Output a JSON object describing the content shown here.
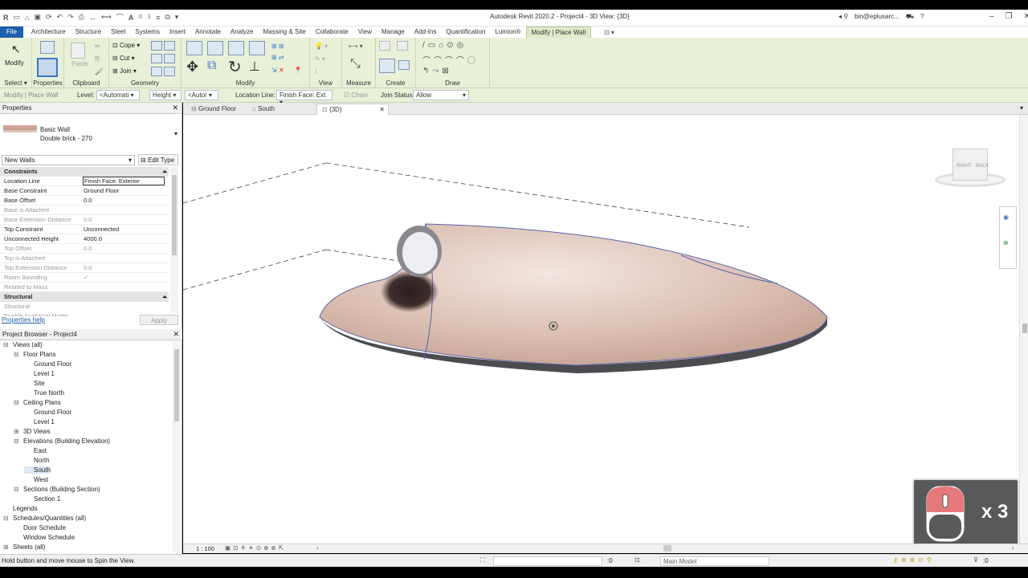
{
  "window": {
    "title": "Autodesk Revit 2020.2 - Project4 - 3D View: {3D}",
    "user": "bin@eplusarc...",
    "controls": [
      "minimize-icon",
      "restore-icon",
      "close-icon"
    ]
  },
  "menu": {
    "file": "File",
    "tabs": [
      "Architecture",
      "Structure",
      "Steel",
      "Systems",
      "Insert",
      "Annotate",
      "Analyze",
      "Massing & Site",
      "Collaborate",
      "View",
      "Manage",
      "Add-Ins",
      "Quantification",
      "Lumion®",
      "Modify | Place Wall"
    ],
    "active_tab": "Modify | Place Wall"
  },
  "ribbon": {
    "modify": "Modify",
    "paste": "Paste",
    "cope": "Cope",
    "cut": "Cut",
    "join": "Join",
    "groups": [
      "Select",
      "Properties",
      "Clipboard",
      "Geometry",
      "Modify",
      "View",
      "Measure",
      "Create",
      "Draw"
    ]
  },
  "options_bar": {
    "context": "Modify | Place Wall",
    "level_label": "Level:",
    "level_value": "<Automati",
    "height_label": "Height",
    "height_value": "<Autor",
    "location_label": "Location Line:",
    "location_value": "Finish Face: Ext",
    "chain": "Chain",
    "join_label": "Join Status:",
    "join_value": "Allow"
  },
  "properties": {
    "header": "Properties",
    "type_name": "Basic Wall",
    "type_sub": "Double brick - 270",
    "filter": "New Walls",
    "edit_type": "Edit Type",
    "sections": {
      "constraints": "Constraints",
      "structural": "Structural"
    },
    "rows": [
      {
        "key": "Location Line",
        "value": "Finish Face: Exterior",
        "dim": false
      },
      {
        "key": "Base Constraint",
        "value": "Ground Floor",
        "dim": false
      },
      {
        "key": "Base Offset",
        "value": "0.0",
        "dim": false
      },
      {
        "key": "Base is Attached",
        "value": "",
        "dim": true
      },
      {
        "key": "Base Extension Distance",
        "value": "0.0",
        "dim": true
      },
      {
        "key": "Top Constraint",
        "value": "Unconnected",
        "dim": false
      },
      {
        "key": "Unconnected Height",
        "value": "4000.0",
        "dim": false
      },
      {
        "key": "Top Offset",
        "value": "0.0",
        "dim": true
      },
      {
        "key": "Top is Attached",
        "value": "",
        "dim": true
      },
      {
        "key": "Top Extension Distance",
        "value": "0.0",
        "dim": true
      },
      {
        "key": "Room Bounding",
        "value": "✓",
        "dim": true
      },
      {
        "key": "Related to Mass",
        "value": "",
        "dim": true
      }
    ],
    "structural_rows": [
      {
        "key": "Structural",
        "value": "",
        "dim": true
      },
      {
        "key": "Enable Analytical Model",
        "value": "",
        "dim": true
      }
    ],
    "help": "Properties help",
    "apply": "Apply"
  },
  "browser": {
    "header": "Project Browser - Project4",
    "items": [
      {
        "label": "Views (all)",
        "indent": 0,
        "expander": "⊟"
      },
      {
        "label": "Floor Plans",
        "indent": 1,
        "expander": "⊟"
      },
      {
        "label": "Ground Floor",
        "indent": 2,
        "expander": ""
      },
      {
        "label": "Level 1",
        "indent": 2,
        "expander": ""
      },
      {
        "label": "Site",
        "indent": 2,
        "expander": ""
      },
      {
        "label": "True North",
        "indent": 2,
        "expander": ""
      },
      {
        "label": "Ceiling Plans",
        "indent": 1,
        "expander": "⊟"
      },
      {
        "label": "Ground Floor",
        "indent": 2,
        "expander": ""
      },
      {
        "label": "Level 1",
        "indent": 2,
        "expander": ""
      },
      {
        "label": "3D Views",
        "indent": 1,
        "expander": "⊞"
      },
      {
        "label": "Elevations (Building Elevation)",
        "indent": 1,
        "expander": "⊟"
      },
      {
        "label": "East",
        "indent": 2,
        "expander": ""
      },
      {
        "label": "North",
        "indent": 2,
        "expander": ""
      },
      {
        "label": "South",
        "indent": 2,
        "expander": "",
        "selected": true
      },
      {
        "label": "West",
        "indent": 2,
        "expander": ""
      },
      {
        "label": "Sections (Building Section)",
        "indent": 1,
        "expander": "⊟"
      },
      {
        "label": "Section 1",
        "indent": 2,
        "expander": ""
      },
      {
        "label": "Legends",
        "indent": 0,
        "expander": ""
      },
      {
        "label": "Schedules/Quantities (all)",
        "indent": 0,
        "expander": "⊟"
      },
      {
        "label": "Door Schedule",
        "indent": 1,
        "expander": ""
      },
      {
        "label": "Window Schedule",
        "indent": 1,
        "expander": ""
      },
      {
        "label": "Sheets (all)",
        "indent": 0,
        "expander": "⊞"
      }
    ]
  },
  "view_tabs": [
    {
      "label": "Ground Floor",
      "active": false
    },
    {
      "label": "South",
      "active": false
    },
    {
      "label": "{3D}",
      "active": true
    }
  ],
  "viewcube": {
    "right": "RIGHT",
    "back": "BACK"
  },
  "view_controls": {
    "scale": "1 : 100"
  },
  "status": {
    "message": "Hold button and move mouse to Spin the View.",
    "selection_count": ":0",
    "model": "Main Model",
    "filter_count": ":0"
  },
  "overlay": {
    "click_count": "x 3"
  }
}
